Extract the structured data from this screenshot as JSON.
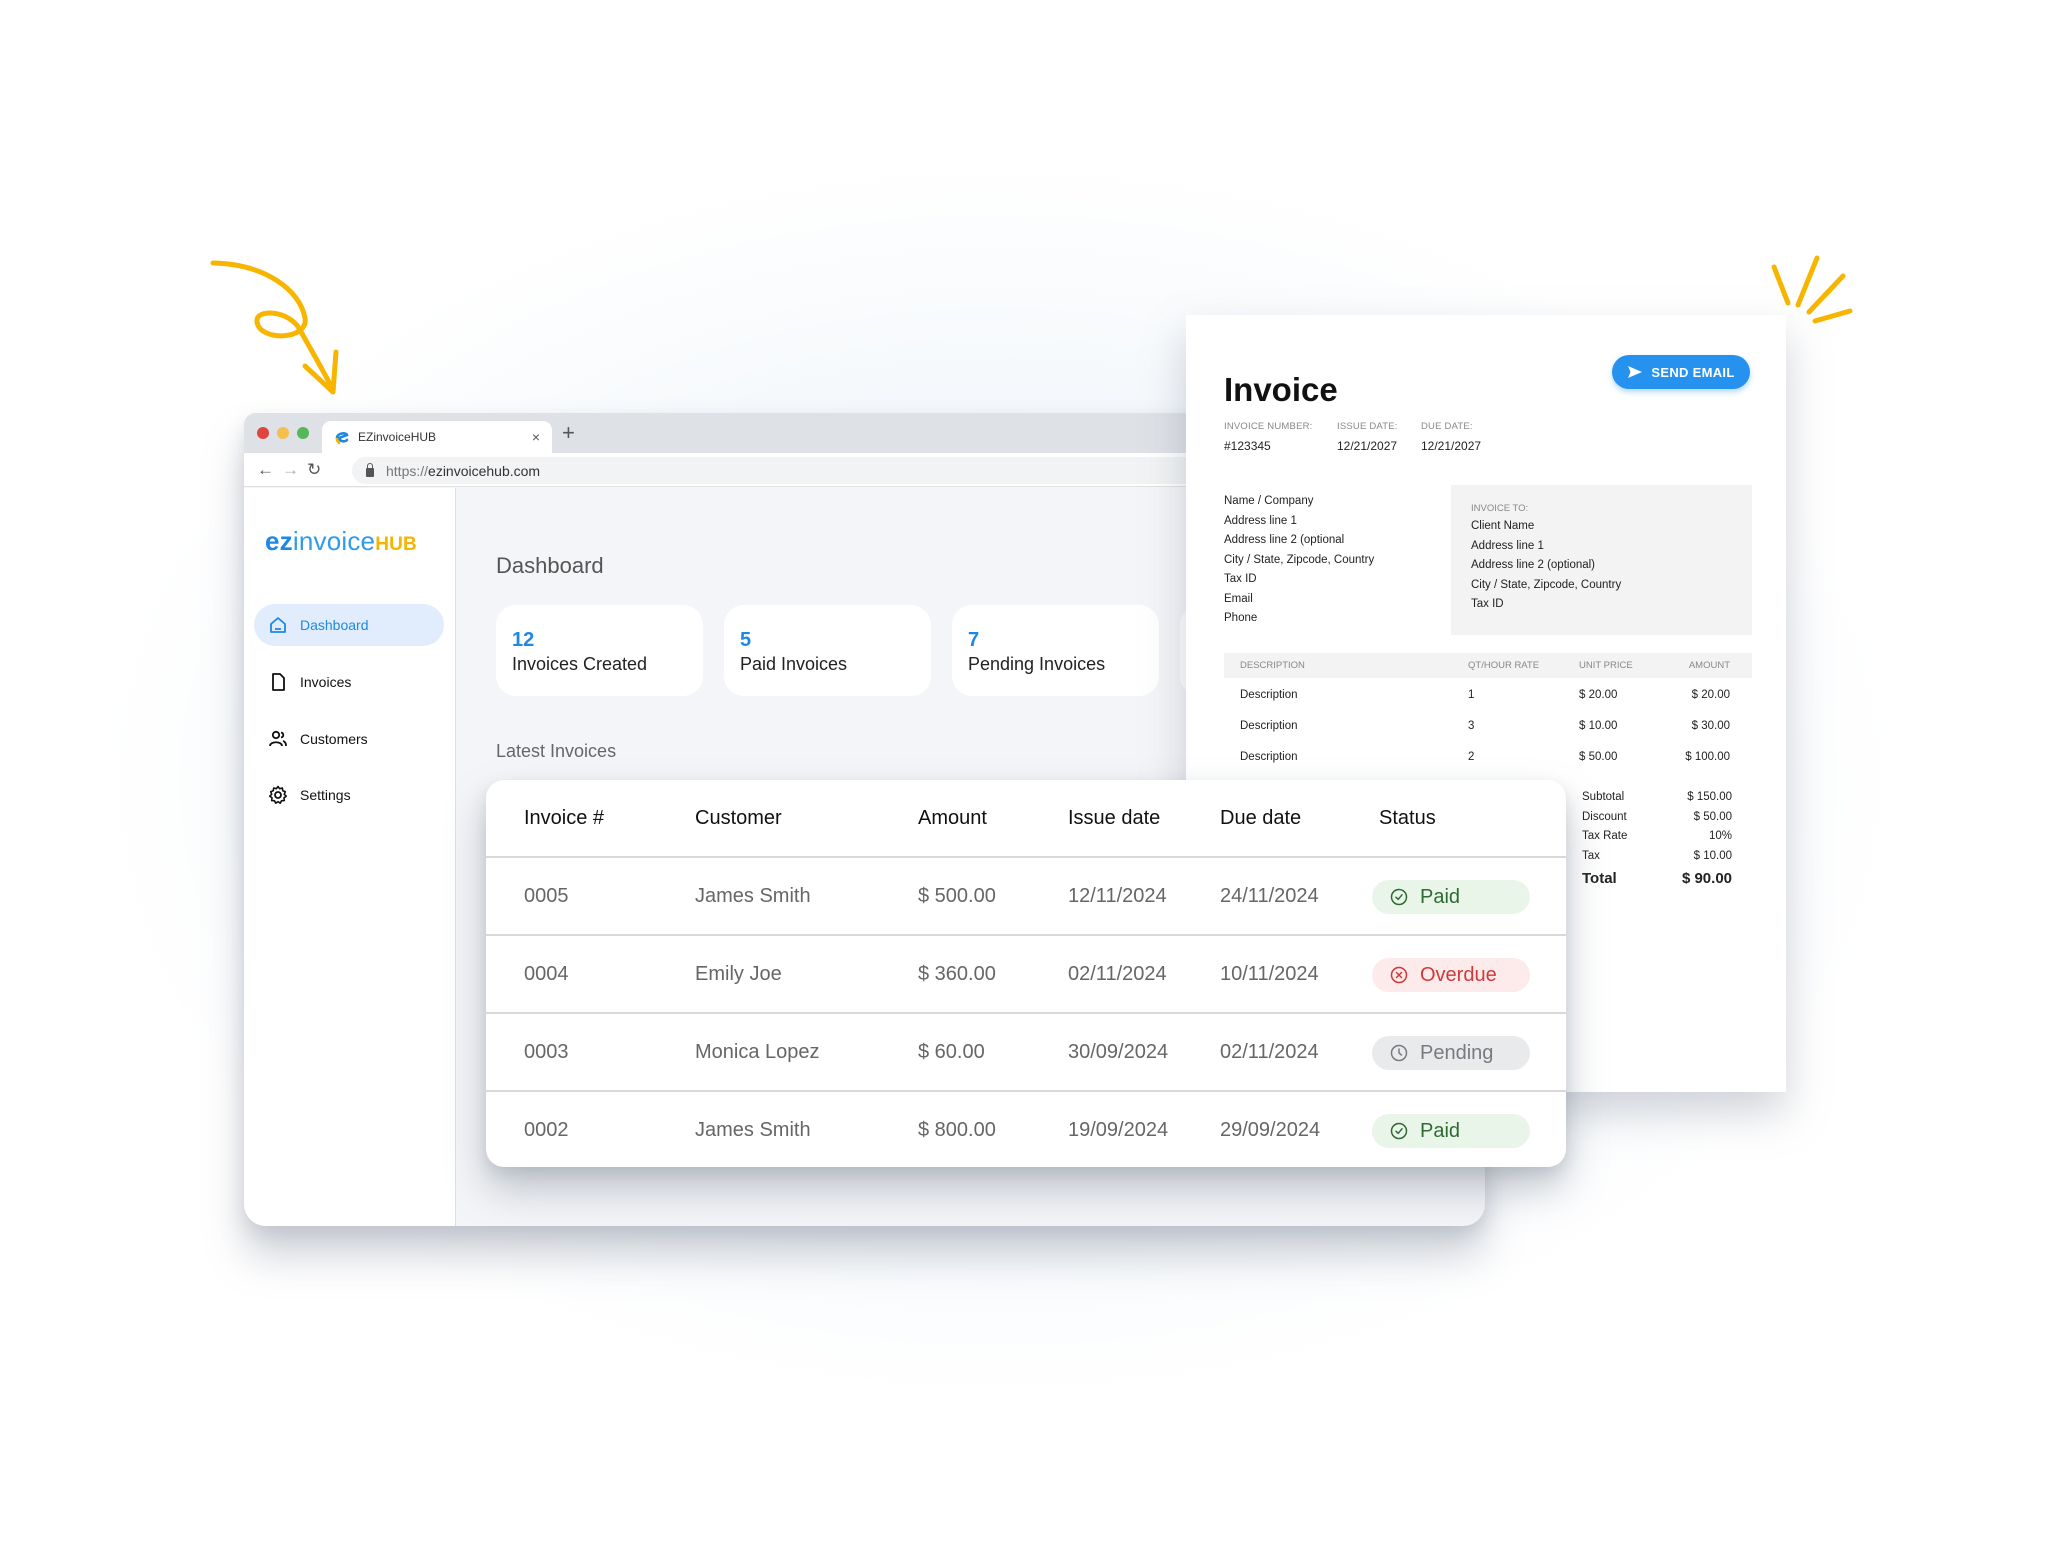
{
  "browser": {
    "tab_title": "EZinvoiceHUB",
    "tab_close": "×",
    "new_tab": "+",
    "url_prefix": "https://",
    "url_host": "ezinvoicehub.com",
    "back": "←",
    "forward": "→",
    "reload": "↻"
  },
  "logo": {
    "ez": "ez",
    "invoice": "invoice",
    "hub": "HUB"
  },
  "sidebar": {
    "items": [
      {
        "label": "Dashboard",
        "icon": "home-icon",
        "active": true
      },
      {
        "label": "Invoices",
        "icon": "document-icon",
        "active": false
      },
      {
        "label": "Customers",
        "icon": "users-icon",
        "active": false
      },
      {
        "label": "Settings",
        "icon": "gear-icon",
        "active": false
      }
    ]
  },
  "dashboard": {
    "title": "Dashboard",
    "stats": [
      {
        "value": "12",
        "label": "Invoices Created"
      },
      {
        "value": "5",
        "label": "Paid Invoices"
      },
      {
        "value": "7",
        "label": "Pending Invoices"
      }
    ],
    "latest_title": "Latest Invoices"
  },
  "table": {
    "headers": [
      "Invoice #",
      "Customer",
      "Amount",
      "Issue date",
      "Due date",
      "Status"
    ],
    "rows": [
      {
        "invoice": "0005",
        "customer": "James Smith",
        "amount": "$ 500.00",
        "issue": "12/11/2024",
        "due": "24/11/2024",
        "status": "Paid"
      },
      {
        "invoice": "0004",
        "customer": "Emily Joe",
        "amount": "$ 360.00",
        "issue": "02/11/2024",
        "due": "10/11/2024",
        "status": "Overdue"
      },
      {
        "invoice": "0003",
        "customer": "Monica Lopez",
        "amount": "$ 60.00",
        "issue": "30/09/2024",
        "due": "02/11/2024",
        "status": "Pending"
      },
      {
        "invoice": "0002",
        "customer": "James Smith",
        "amount": "$ 800.00",
        "issue": "19/09/2024",
        "due": "29/09/2024",
        "status": "Paid"
      }
    ],
    "status_colors": {
      "Paid": {
        "bg": "#eaf5ea",
        "fg": "#2e6b33"
      },
      "Overdue": {
        "bg": "#fdeaea",
        "fg": "#d0393b"
      },
      "Pending": {
        "bg": "#e9eaec",
        "fg": "#777b80"
      }
    }
  },
  "invoice": {
    "title": "Invoice",
    "send_button": "SEND EMAIL",
    "meta": [
      {
        "label": "INVOICE NUMBER:",
        "value": "#123345"
      },
      {
        "label": "ISSUE DATE:",
        "value": "12/21/2027"
      },
      {
        "label": "DUE DATE:",
        "value": "12/21/2027"
      }
    ],
    "from_lines": [
      "Name / Company",
      "Address line 1",
      "Address line 2 (optional",
      "City / State, Zipcode, Country",
      "Tax ID",
      "Email",
      "Phone"
    ],
    "to_label": "INVOICE TO:",
    "to_lines": [
      "Client Name",
      "Address line 1",
      "Address line 2 (optional)",
      "City / State, Zipcode, Country",
      "Tax ID"
    ],
    "item_headers": [
      "DESCRIPTION",
      "QT/HOUR RATE",
      "UNIT PRICE",
      "AMOUNT"
    ],
    "items": [
      {
        "desc": "Description",
        "qty": "1",
        "unit": "$ 20.00",
        "amount": "$ 20.00"
      },
      {
        "desc": "Description",
        "qty": "3",
        "unit": "$ 10.00",
        "amount": "$ 30.00"
      },
      {
        "desc": "Description",
        "qty": "2",
        "unit": "$ 50.00",
        "amount": "$ 100.00"
      }
    ],
    "totals": [
      {
        "label": "Subtotal",
        "value": "$ 150.00"
      },
      {
        "label": "Discount",
        "value": "$ 50.00"
      },
      {
        "label": "Tax Rate",
        "value": "10%"
      },
      {
        "label": "Tax",
        "value": "$ 10.00"
      }
    ],
    "total": {
      "label": "Total",
      "value": "$ 90.00"
    }
  },
  "colors": {
    "accent": "#1e88e5",
    "logo_hub": "#f5b400",
    "decoration": "#f7b500"
  }
}
